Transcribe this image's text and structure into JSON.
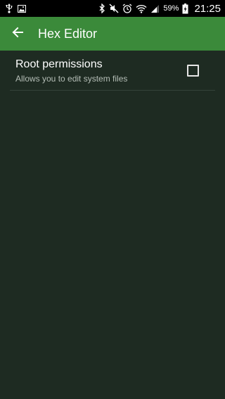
{
  "status_bar": {
    "battery_percent": "59%",
    "time": "21:25",
    "icons": [
      "usb-icon",
      "image-icon",
      "bluetooth-icon",
      "mute-icon",
      "alarm-icon",
      "wifi-icon",
      "signal-icon",
      "battery-charging-icon"
    ]
  },
  "app_bar": {
    "title": "Hex Editor",
    "back_icon": "arrow-left-icon",
    "color": "#3b8a3a"
  },
  "preferences": [
    {
      "title": "Root permissions",
      "summary": "Allows you to edit system files",
      "checked": false
    }
  ],
  "colors": {
    "background": "#1e2b22",
    "accent": "#3b8a3a"
  }
}
